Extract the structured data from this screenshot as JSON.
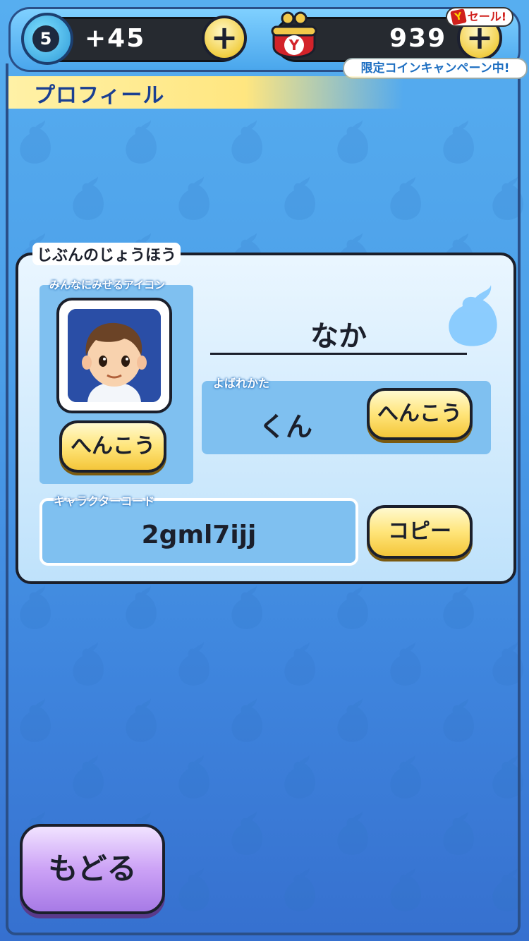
{
  "header": {
    "stamina_level": "5",
    "stamina_value": "+45",
    "coin_value": "939",
    "sale_tag": "セール!",
    "sale_tag_logo": "Y",
    "campaign_text": "限定コインキャンペーン中!"
  },
  "page": {
    "title": "プロフィール"
  },
  "profile": {
    "section_title": "じぶんのじょうほう",
    "icon_label": "みんなにみせるアイコン",
    "icon_change_button": "へんこう",
    "player_name": "なか",
    "honorific_label": "よばれかた",
    "honorific_value": "くん",
    "honorific_change_button": "へんこう",
    "character_code_label": "キャラクターコード",
    "character_code": "2gml7ijj",
    "copy_button": "コピー"
  },
  "footer": {
    "back_button": "もどる"
  },
  "colors": {
    "panel_border": "#1b1f2b",
    "button_gold": "#ffe57a",
    "back_purple": "#cca2f6",
    "bg_blue": "#4b9ee8"
  }
}
